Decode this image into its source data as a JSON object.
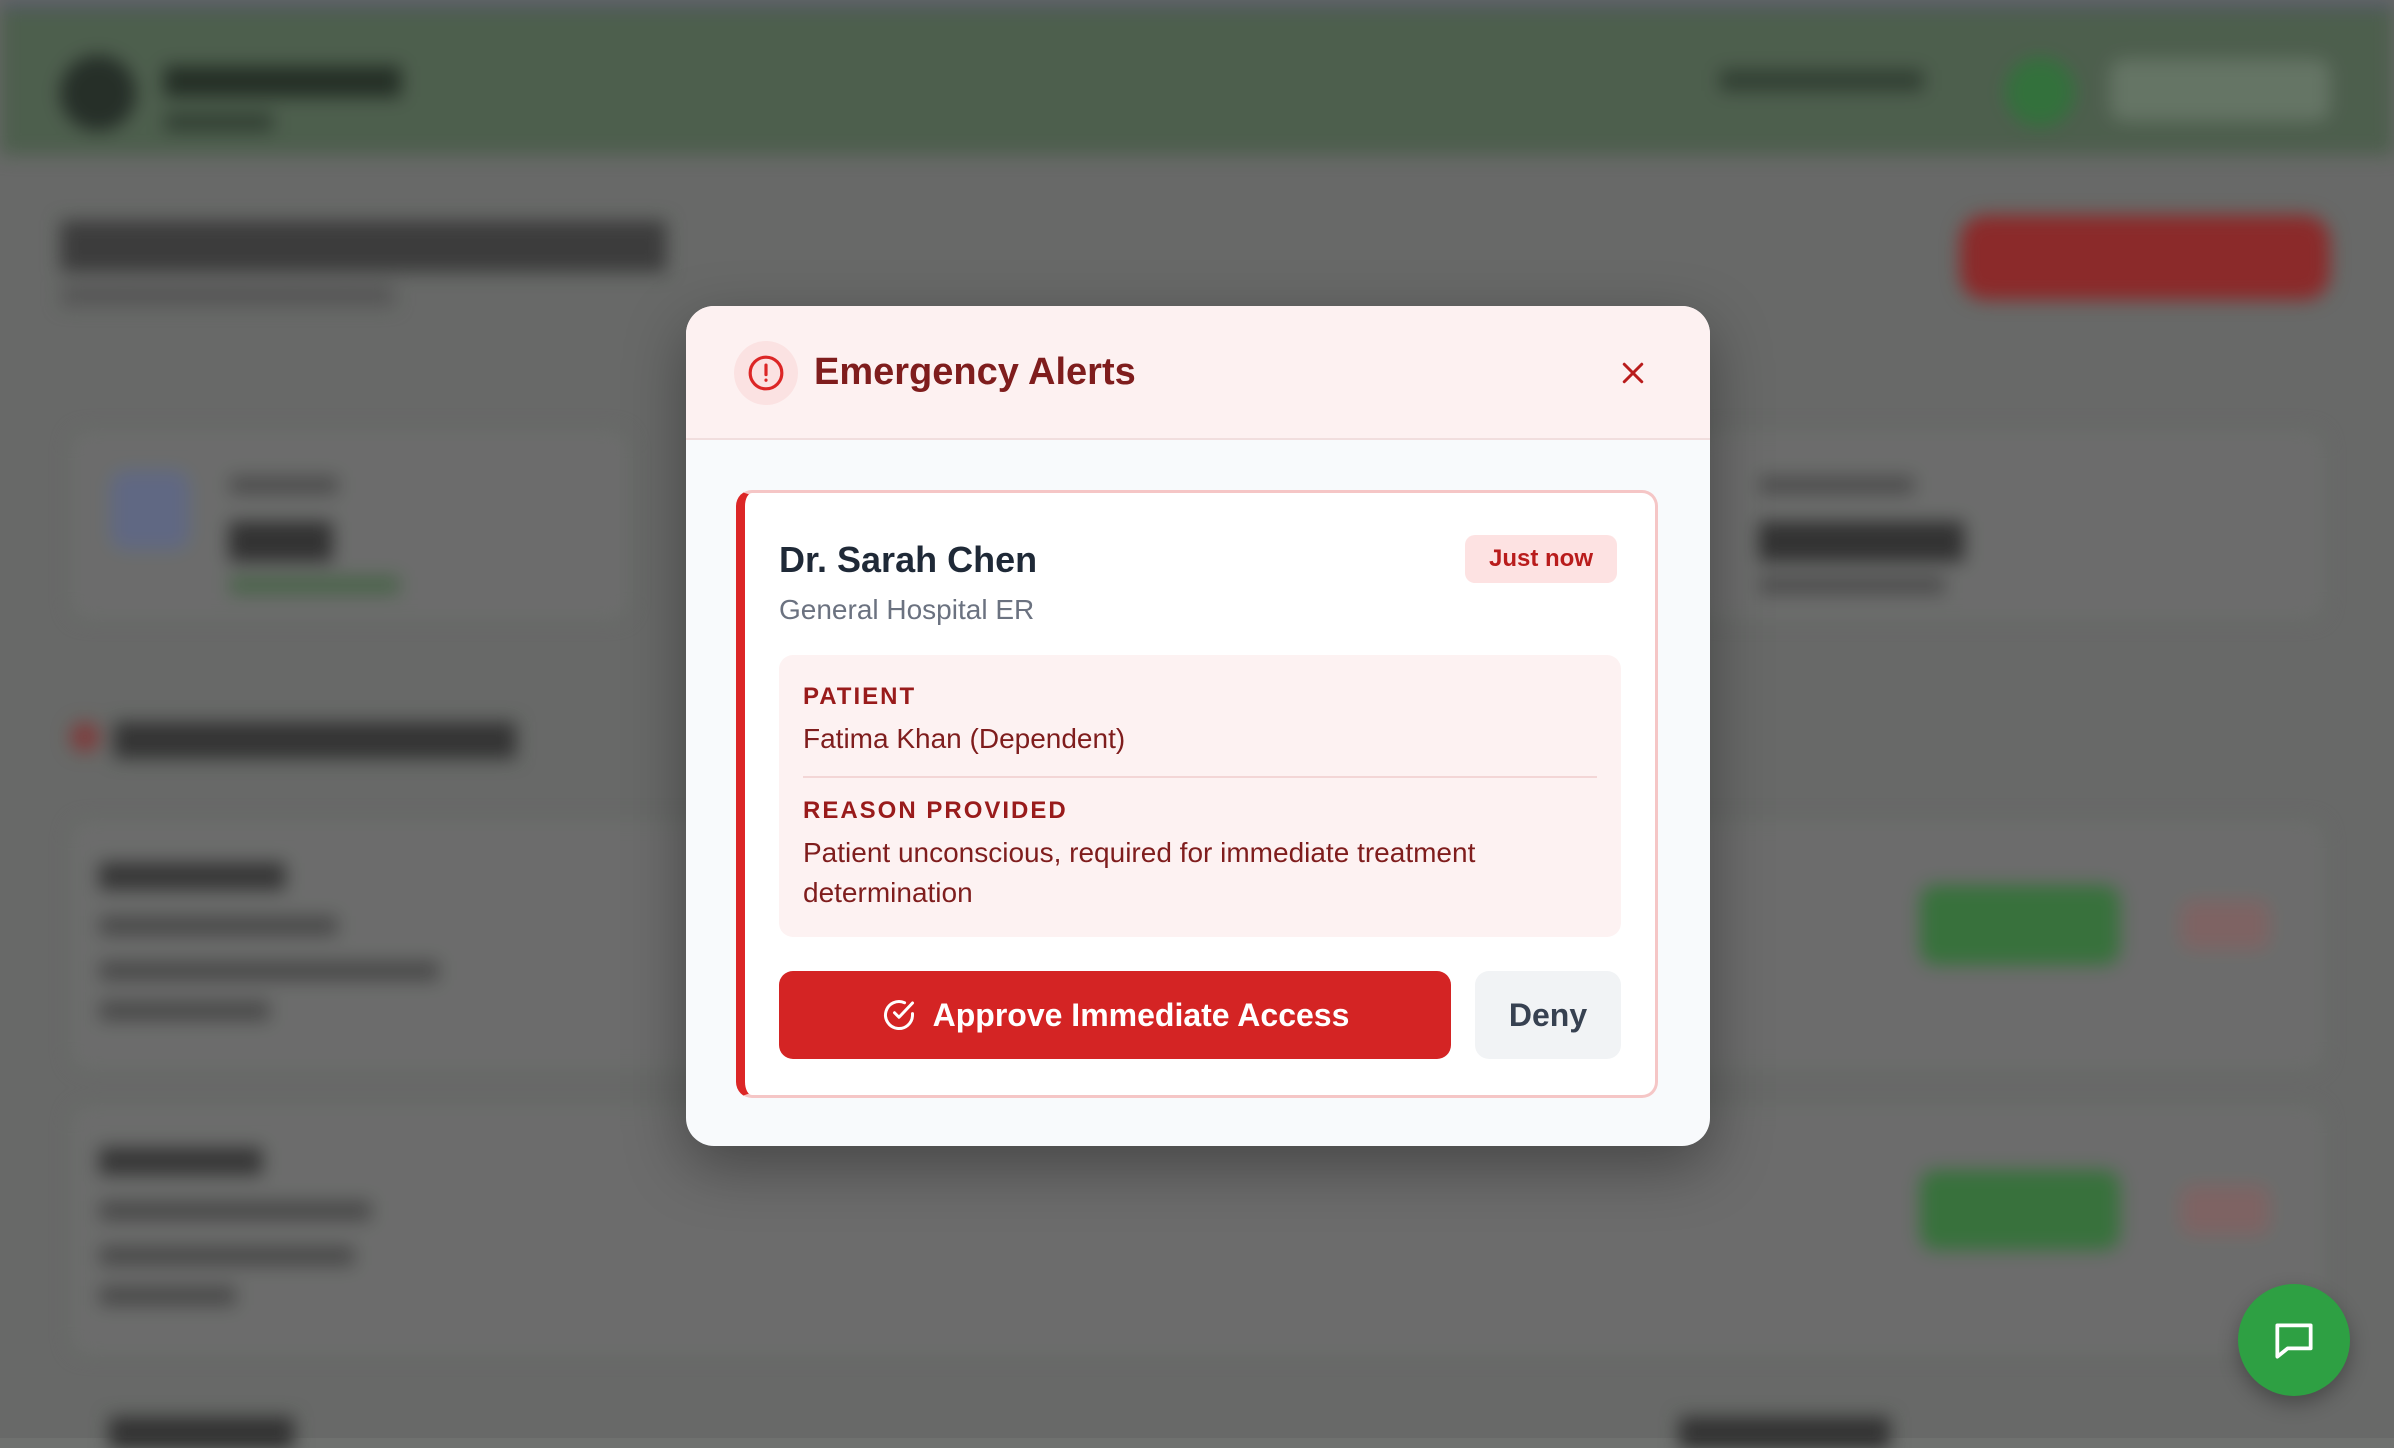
{
  "modal": {
    "title": "Emergency Alerts",
    "icon": "alert-circle-icon",
    "close_icon": "close-icon",
    "alert": {
      "doctor_name": "Dr. Sarah Chen",
      "facility": "General Hospital ER",
      "time_badge": "Just now",
      "patient_label": "PATIENT",
      "patient_value": "Fatima Khan (Dependent)",
      "reason_label": "REASON PROVIDED",
      "reason_value": "Patient unconscious, required for immediate treatment determination",
      "approve_label": "Approve Immediate Access",
      "approve_icon": "check-circle-icon",
      "deny_label": "Deny"
    }
  },
  "chat_fab": {
    "icon": "chat-bubble-icon"
  },
  "colors": {
    "danger": "#d42424",
    "danger_dark": "#7f1d1d",
    "header_bg": "#fdf1f1",
    "fab": "#2ea043"
  }
}
